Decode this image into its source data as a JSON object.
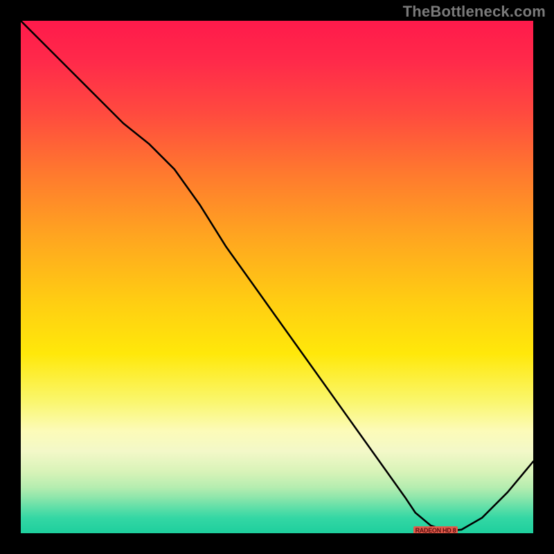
{
  "attribution": "TheBottleneck.com",
  "badge_text": "RADEON HD 8",
  "chart_data": {
    "type": "line",
    "title": "",
    "xlabel": "",
    "ylabel": "",
    "xlim": [
      0,
      100
    ],
    "ylim": [
      0,
      100
    ],
    "x": [
      0,
      5,
      10,
      15,
      20,
      25,
      30,
      35,
      40,
      45,
      50,
      55,
      60,
      65,
      70,
      75,
      77,
      80,
      82,
      84,
      86,
      90,
      95,
      100
    ],
    "values": [
      100,
      95,
      90,
      85,
      80,
      76,
      71,
      64,
      56,
      49,
      42,
      35,
      28,
      21,
      14,
      7,
      4,
      1.5,
      0.8,
      0.5,
      0.7,
      3,
      8,
      14
    ],
    "series": [
      {
        "name": "bottleneck-curve",
        "x_ref": "x",
        "y_ref": "values"
      }
    ],
    "grid": false,
    "legend": false
  },
  "colors": {
    "background": "#000000",
    "curve": "#000000",
    "attribution": "#7a7a7a",
    "badge_bg": "#e25a4a",
    "badge_fg": "#5a0f0f"
  }
}
